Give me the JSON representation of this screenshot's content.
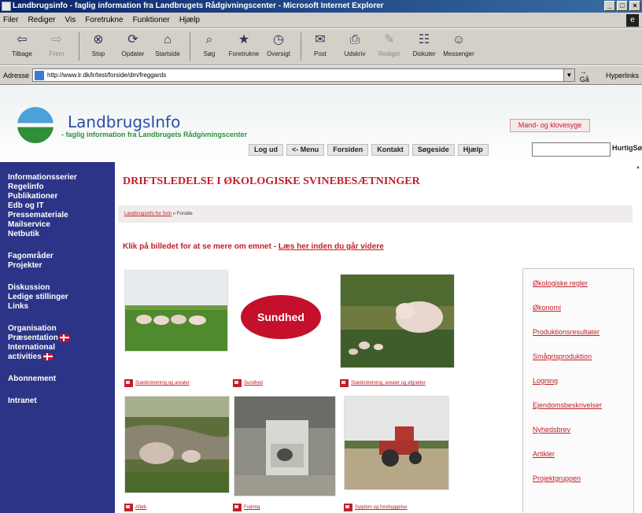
{
  "window": {
    "title": "Landbrugsinfo - faglig information fra Landbrugets Rådgivningscenter - Microsoft Internet Explorer",
    "controls": [
      "_",
      "□",
      "×"
    ]
  },
  "menu": [
    "Filer",
    "Rediger",
    "Vis",
    "Foretrukne",
    "Funktioner",
    "Hjælp"
  ],
  "toolbar": {
    "buttons": [
      {
        "label": "Tilbage",
        "icon": "back-arrow-icon",
        "glyph": "⇦",
        "enabled": true
      },
      {
        "label": "Frem",
        "icon": "forward-arrow-icon",
        "glyph": "⇨",
        "enabled": false
      },
      {
        "label": "Stop",
        "icon": "stop-icon",
        "glyph": "⊗",
        "enabled": true
      },
      {
        "label": "Opdater",
        "icon": "refresh-icon",
        "glyph": "⟳",
        "enabled": true
      },
      {
        "label": "Startside",
        "icon": "home-icon",
        "glyph": "⌂",
        "enabled": true
      },
      {
        "label": "Søg",
        "icon": "search-icon",
        "glyph": "⌕",
        "enabled": true
      },
      {
        "label": "Foretrukne",
        "icon": "favorites-icon",
        "glyph": "★",
        "enabled": true
      },
      {
        "label": "Oversigt",
        "icon": "history-icon",
        "glyph": "◷",
        "enabled": true
      },
      {
        "label": "Post",
        "icon": "mail-icon",
        "glyph": "✉",
        "enabled": true
      },
      {
        "label": "Udskriv",
        "icon": "print-icon",
        "glyph": "⎙",
        "enabled": true
      },
      {
        "label": "Rediger",
        "icon": "edit-icon",
        "glyph": "✎",
        "enabled": false
      },
      {
        "label": "Diskuter",
        "icon": "discuss-icon",
        "glyph": "☷",
        "enabled": true
      },
      {
        "label": "Messenger",
        "icon": "messenger-icon",
        "glyph": "☺",
        "enabled": true
      }
    ]
  },
  "address": {
    "label": "Adresse",
    "url": "http://www.lr.dk/lr/test/forside/dm/freggards",
    "go_label": "Gå",
    "links_label": "Hyperlinks"
  },
  "site": {
    "name": "LandbrugsInfo",
    "tagline": "- faglig information fra Landbrugets Rådgivningscenter",
    "header_button": "Mand- og klovesyge",
    "nav": [
      "Log ud",
      "<- Menu",
      "Forsiden",
      "Kontakt",
      "Søgeside",
      "Hjælp"
    ],
    "search_placeholder": "",
    "search_button": "HurtigSøg"
  },
  "sidebar": {
    "groups": [
      {
        "items": [
          {
            "label": "Informationsserier"
          },
          {
            "label": "Regelinfo"
          },
          {
            "label": "Publikationer"
          },
          {
            "label": "Edb og IT"
          },
          {
            "label": "Pressemateriale"
          },
          {
            "label": "Mailservice"
          },
          {
            "label": "Netbutik"
          }
        ]
      },
      {
        "items": [
          {
            "label": "Fagområder"
          },
          {
            "label": "Projekter"
          }
        ]
      },
      {
        "items": [
          {
            "label": "Diskussion"
          },
          {
            "label": "Ledige stillinger"
          },
          {
            "label": "Links"
          }
        ]
      },
      {
        "items": [
          {
            "label": "Organisation"
          },
          {
            "label": "Præsentation",
            "flag": true
          },
          {
            "label": "International"
          },
          {
            "label": "activities",
            "flag": true
          }
        ]
      },
      {
        "items": [
          {
            "label": "Abonnement"
          }
        ]
      },
      {
        "items": [
          {
            "label": "Intranet"
          }
        ]
      }
    ]
  },
  "main": {
    "title": "DRIFTSLEDELSE I ØKOLOGISKE SVINEBESÆTNINGER",
    "breadcrumb": {
      "link": "Landbrugsinfo for Svin",
      "sep": " » ",
      "current": "Forside"
    },
    "intro": {
      "text": "Klik på billedet for at se mere om emnet",
      "dash": " - ",
      "link": "Læs her inden du går videre"
    },
    "sundhed_label": "Sundhed",
    "captions": [
      "Staldindretning og arealer",
      "Sundhed",
      "Staldindretning, arealer og afgrøder",
      "Afløb",
      "Fodring",
      "Sygdom og forebyggelse"
    ]
  },
  "right_box": {
    "links": [
      "Økologiske regler",
      "Økonomi",
      "Produktionsresultater",
      "Smågrisproduktion",
      "Logning",
      "Ejendomsbeskrivelser",
      "Nyhedsbrev",
      "Artikler",
      "Projektgruppen"
    ]
  },
  "colors": {
    "sidebar_bg": "#2b3487",
    "accent_red": "#c0202a",
    "sundhed_bg": "#c4102a",
    "title_blue": "#2c4ea6",
    "tagline_green": "#2f8f3a"
  }
}
